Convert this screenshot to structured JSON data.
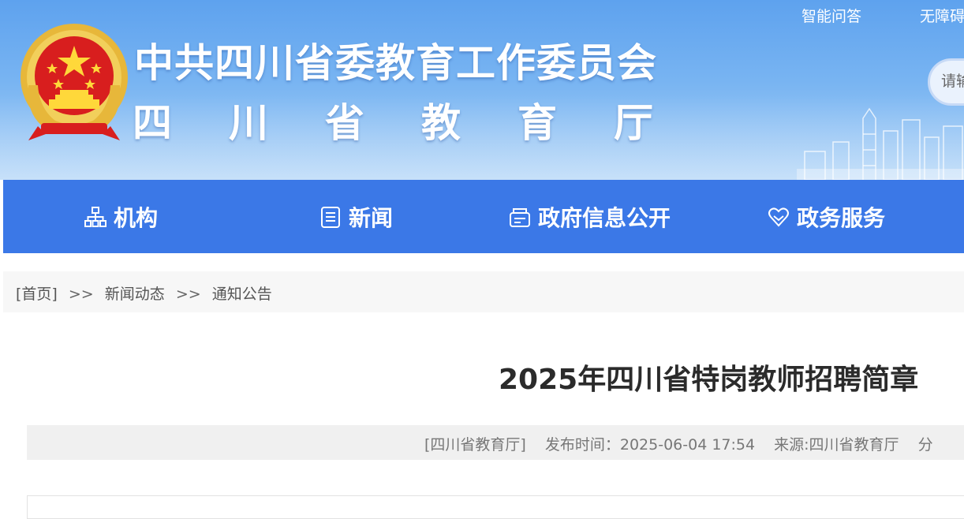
{
  "header": {
    "title_main": "中共四川省委教育工作委员会",
    "title_sub": "四川省教育厅",
    "top_links": [
      "智能问答",
      "无障碍"
    ],
    "search_placeholder": "请输入",
    "emblem_icon": "national-emblem-icon"
  },
  "nav": {
    "items": [
      {
        "label": "机构",
        "icon": "org-chart-icon"
      },
      {
        "label": "新闻",
        "icon": "news-icon"
      },
      {
        "label": "政府信息公开",
        "icon": "info-disclosure-icon"
      },
      {
        "label": "政务服务",
        "icon": "service-heart-icon"
      }
    ]
  },
  "breadcrumb": {
    "items": [
      "[首页]",
      "新闻动态",
      "通知公告"
    ],
    "separator": ">>"
  },
  "article": {
    "title": "2025年四川省特岗教师招聘简章",
    "source_tag": "[四川省教育厅]",
    "publish_time": "发布时间：2025-06-04 17:54",
    "source": "来源:四川省教育厅",
    "share": "分"
  },
  "colors": {
    "nav_bg": "#3b78e7",
    "banner_top": "#5ea2ee",
    "title_text": "#2b2b2b"
  }
}
